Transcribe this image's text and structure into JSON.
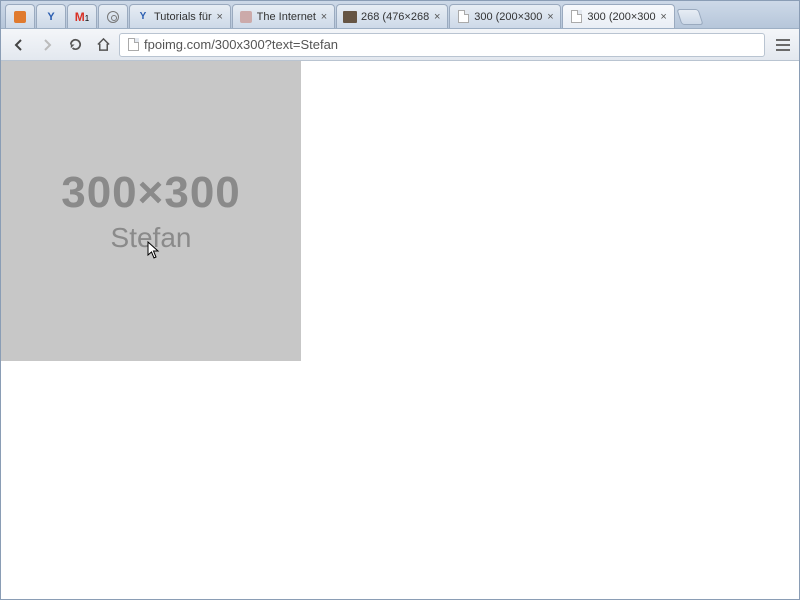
{
  "pinned": [
    {
      "name": "pinned-1",
      "icon": "orange-square-icon"
    },
    {
      "name": "pinned-2",
      "icon": "yoast-icon"
    },
    {
      "name": "pinned-3",
      "icon": "gmail-icon",
      "badge": "1"
    },
    {
      "name": "pinned-4",
      "icon": "circle-icon"
    }
  ],
  "tabs": [
    {
      "label": "Tutorials für",
      "icon": "yoast-icon",
      "active": false
    },
    {
      "label": "The Internet",
      "icon": "head-icon",
      "active": false
    },
    {
      "label": "268 (476×268",
      "icon": "thumb-icon",
      "active": false
    },
    {
      "label": "300 (200×300",
      "icon": "doc-icon",
      "active": false
    },
    {
      "label": "300 (200×300",
      "icon": "doc-icon",
      "active": true
    }
  ],
  "toolbar": {
    "url": "fpoimg.com/300x300?text=Stefan"
  },
  "content": {
    "dimensions": "300×300",
    "text": "Stefan"
  }
}
